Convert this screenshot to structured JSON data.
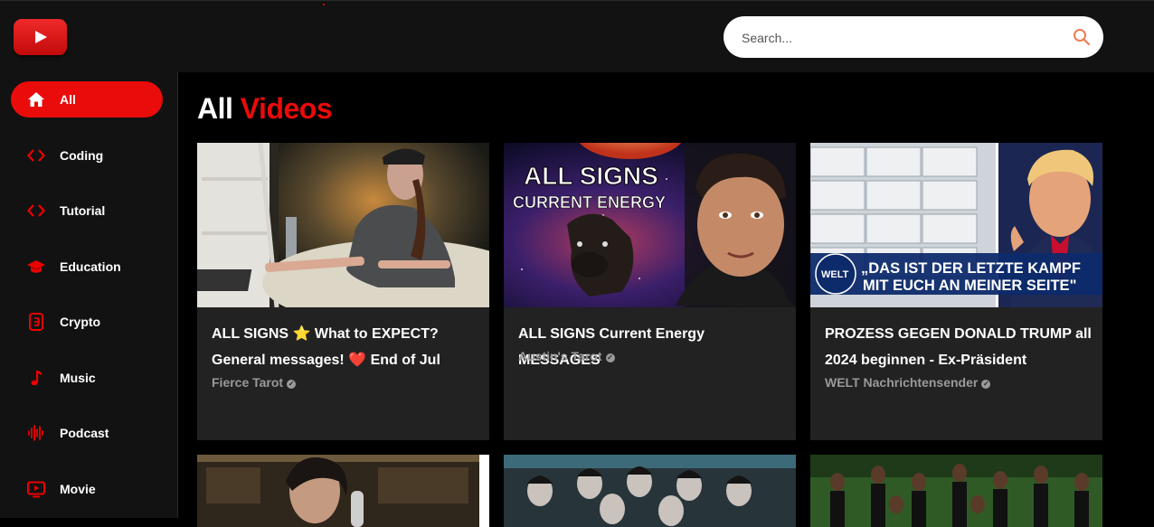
{
  "header": {
    "logo": "play-logo",
    "search_placeholder": "Search..."
  },
  "sidebar": {
    "items": [
      {
        "label": "All",
        "icon": "home-icon",
        "active": true
      },
      {
        "label": "Coding",
        "icon": "code-icon"
      },
      {
        "label": "Tutorial",
        "icon": "code-icon"
      },
      {
        "label": "Education",
        "icon": "graduation-cap-icon"
      },
      {
        "label": "Crypto",
        "icon": "bitcoin-icon"
      },
      {
        "label": "Music",
        "icon": "music-note-icon"
      },
      {
        "label": "Podcast",
        "icon": "podcast-wave-icon"
      },
      {
        "label": "Movie",
        "icon": "tv-play-icon"
      }
    ]
  },
  "main": {
    "heading_part1": "All",
    "heading_part2": "Videos",
    "videos": [
      {
        "title_parts": [
          "ALL SIGNS ",
          " What to EXPECT? General messages! ",
          " End of Jul"
        ],
        "emojis": [
          "⭐",
          "❤️"
        ],
        "channel": "Fierce Tarot"
      },
      {
        "title": "ALL SIGNS Current Energy MESSAGES",
        "channel": "Austin's Tarot",
        "thumb_text_1": "ALL SIGNS",
        "thumb_text_2": "CURRENT ENERGY"
      },
      {
        "title": "PROZESS GEGEN DONALD TRUMP all 2024 beginnen - Ex-Präsident",
        "channel": "WELT Nachrichtensender",
        "thumb_logo": "WELT",
        "thumb_text_1": "„DAS IST DER LETZTE KAMPF",
        "thumb_text_2": "MIT EUCH AN MEINER SEITE\""
      }
    ]
  },
  "colors": {
    "accent": "#ea0b0b",
    "background": "#000000",
    "panel": "#121212",
    "card": "#222222",
    "muted_text": "#9a9a9a"
  }
}
